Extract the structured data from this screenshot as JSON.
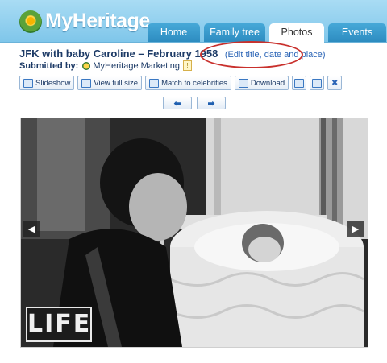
{
  "brand": {
    "name": "MyHeritage"
  },
  "tabs": [
    {
      "label": "Home"
    },
    {
      "label": "Family tree"
    },
    {
      "label": "Photos",
      "active": true
    },
    {
      "label": "Events"
    }
  ],
  "photo": {
    "title": "JFK with baby Caroline – February 1958",
    "edit_link": "(Edit title, date and place)",
    "submitted_label": "Submitted by:",
    "submitted_by": "MyHeritage Marketing",
    "watermark": "LIFE"
  },
  "toolbar": {
    "slideshow": "Slideshow",
    "view_full_size": "View full size",
    "match_celebrities": "Match to celebrities",
    "download": "Download"
  },
  "icons": {
    "slideshow": "slideshow-icon",
    "view_full_size": "zoom-icon",
    "match_celebrities": "people-icon",
    "download": "download-icon",
    "rotate_left": "rotate-left-icon",
    "rotate_right": "rotate-right-icon",
    "delete": "delete-icon",
    "prev": "arrow-left-icon",
    "next": "arrow-right-icon"
  },
  "colors": {
    "header": "#7fc6ea",
    "tab": "#2d8cc0",
    "title": "#1c3a66",
    "link": "#2a64b6",
    "highlight_oval": "#c9302c"
  }
}
